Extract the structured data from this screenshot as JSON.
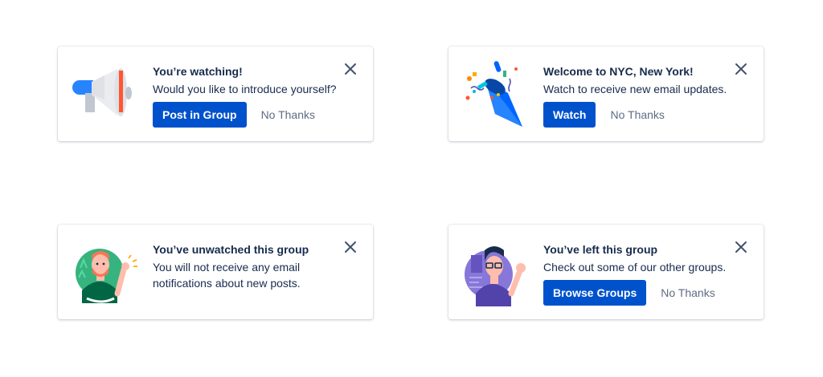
{
  "cards": [
    {
      "title": "You’re watching!",
      "body": "Would you like to introduce yourself?",
      "primary_label": "Post in Group",
      "secondary_label": "No Thanks",
      "illustration_icon": "megaphone-icon"
    },
    {
      "title": "Welcome to NYC, New York!",
      "body": "Watch to receive new email updates.",
      "primary_label": "Watch",
      "secondary_label": "No Thanks",
      "illustration_icon": "party-popper-icon"
    },
    {
      "title": "You’ve unwatched this group",
      "body_line1": "You will not receive any email",
      "body_line2": "notifications about new posts.",
      "illustration_icon": "waving-person-icon"
    },
    {
      "title": "You’ve left this group",
      "body": "Check out some of our other groups.",
      "primary_label": "Browse Groups",
      "secondary_label": "No Thanks",
      "illustration_icon": "waving-person-glasses-icon"
    }
  ],
  "close_icon": "close-icon",
  "colors": {
    "primary_button": "#0052CC",
    "title_text": "#172B4D",
    "subtle_text": "#5E6C84"
  }
}
